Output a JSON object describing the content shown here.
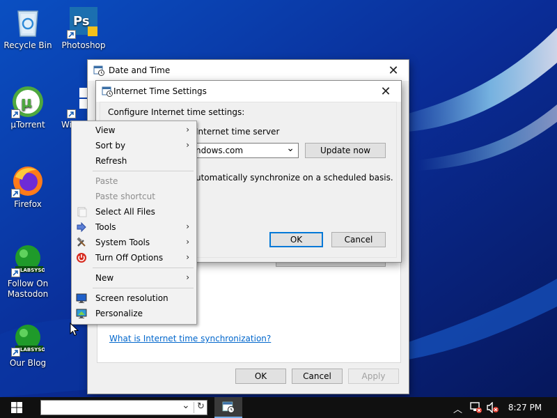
{
  "desktop": {
    "icons": [
      {
        "label": "Recycle Bin"
      },
      {
        "label": "Photoshop"
      },
      {
        "label": "µTorrent"
      },
      {
        "label": "Wi"
      },
      {
        "label": "Firefox"
      },
      {
        "label": "Follow On Mastodon"
      },
      {
        "label": "Our Blog"
      }
    ]
  },
  "date_time_dialog": {
    "title": "Date and Time",
    "link": "What is Internet time synchronization?",
    "ok": "OK",
    "cancel": "Cancel",
    "apply": "Apply"
  },
  "internet_time_dialog": {
    "title": "Internet Time Settings",
    "heading": "Configure Internet time settings:",
    "server_label_visible": "Internet time server",
    "server_value_visible": "ndows.com",
    "update_button": "Update now",
    "sync_text_visible": "utomatically synchronize on a scheduled basis.",
    "ok": "OK",
    "cancel": "Cancel"
  },
  "context_menu": {
    "items": [
      {
        "label": "View",
        "submenu": true,
        "enabled": true
      },
      {
        "label": "Sort by",
        "submenu": true,
        "enabled": true
      },
      {
        "label": "Refresh",
        "submenu": false,
        "enabled": true
      },
      {
        "label": "Paste",
        "submenu": false,
        "enabled": false
      },
      {
        "label": "Paste shortcut",
        "submenu": false,
        "enabled": false
      },
      {
        "label": "Select All Files",
        "submenu": false,
        "enabled": true
      },
      {
        "label": "Tools",
        "submenu": true,
        "enabled": true
      },
      {
        "label": "System Tools",
        "submenu": true,
        "enabled": true
      },
      {
        "label": "Turn Off Options",
        "submenu": true,
        "enabled": true
      },
      {
        "label": "New",
        "submenu": true,
        "enabled": true
      },
      {
        "label": "Screen resolution",
        "submenu": false,
        "enabled": true
      },
      {
        "label": "Personalize",
        "submenu": false,
        "enabled": true
      }
    ],
    "submenu_glyph": "›"
  },
  "taskbar": {
    "address_value": "",
    "clock": "8:27 PM"
  },
  "glyphs": {
    "close": "✕",
    "dropdown": "⌄",
    "refresh": "↻",
    "tray_up": "︿"
  }
}
